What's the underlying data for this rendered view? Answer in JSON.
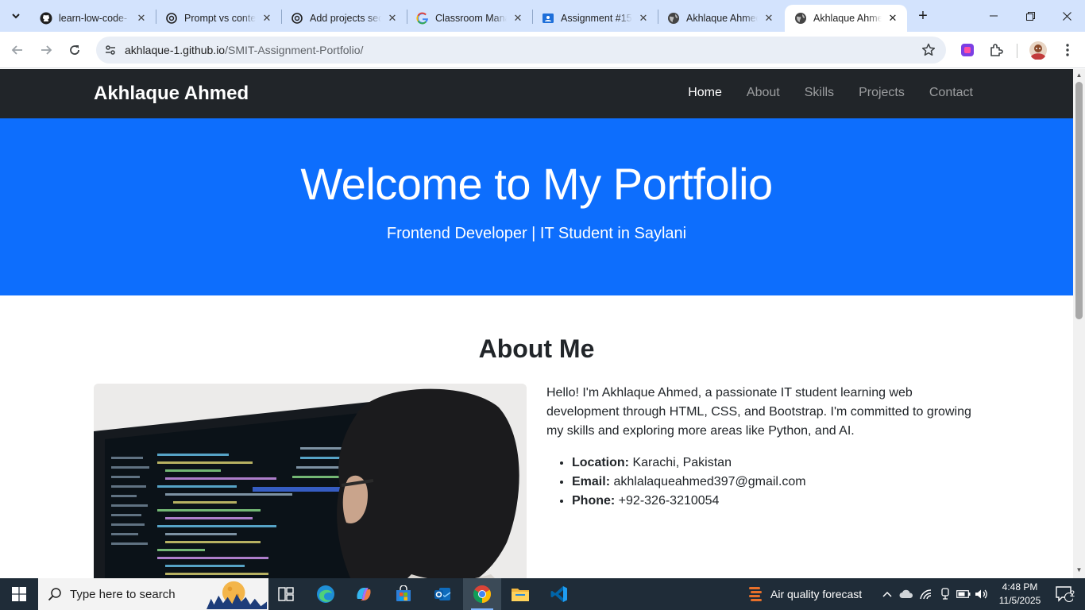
{
  "browser": {
    "tabs": [
      {
        "title": "learn-low-code-",
        "icon": "github-icon"
      },
      {
        "title": "Prompt vs conte",
        "icon": "openai-icon"
      },
      {
        "title": "Add projects sec",
        "icon": "openai-icon"
      },
      {
        "title": "Classroom Mana",
        "icon": "google-icon"
      },
      {
        "title": "Assignment #15",
        "icon": "classroom-icon"
      },
      {
        "title": "Akhlaque Ahmed",
        "icon": "globe-icon"
      },
      {
        "title": "Akhlaque Ahmed",
        "icon": "globe-icon",
        "active": true
      }
    ],
    "url_host": "akhlaque-1.github.io",
    "url_path": "/SMIT-Assignment-Portfolio/",
    "colors": {
      "tab_strip": "#d3e3fd",
      "omnibox": "#e9eef6"
    }
  },
  "site": {
    "brand": "Akhlaque Ahmed",
    "nav": [
      "Home",
      "About",
      "Skills",
      "Projects",
      "Contact"
    ],
    "hero": {
      "title": "Welcome to My Portfolio",
      "subtitle": "Frontend Developer | IT Student in Saylani"
    },
    "about": {
      "heading": "About Me",
      "bio": "Hello! I'm Akhlaque Ahmed, a passionate IT student learning web development through HTML, CSS, and Bootstrap. I'm committed to growing my skills and exploring more areas like Python, and AI.",
      "details": [
        {
          "label": "Location:",
          "value": "Karachi, Pakistan"
        },
        {
          "label": "Email:",
          "value": "akhlalaqueahmed397@gmail.com"
        },
        {
          "label": "Phone:",
          "value": "+92-326-3210054"
        }
      ]
    },
    "colors": {
      "navbar": "#212529",
      "hero": "#0d6efd",
      "text": "#212529"
    }
  },
  "taskbar": {
    "search_placeholder": "Type here to search",
    "weather": "Air quality forecast",
    "time": "4:48 PM",
    "date": "11/5/2025",
    "notifications": "2",
    "apps": [
      "task-view-icon",
      "edge-icon",
      "copilot-icon",
      "store-icon",
      "outlook-icon",
      "chrome-icon",
      "file-explorer-icon",
      "vscode-icon"
    ]
  }
}
